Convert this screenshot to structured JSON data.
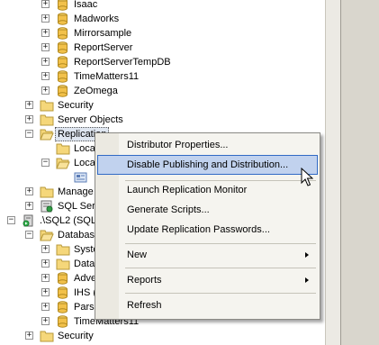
{
  "tree": {
    "databases_above": [
      "Isaac",
      "Madworks",
      "Mirrorsample",
      "ReportServer",
      "ReportServerTempDB",
      "TimeMatters11",
      "ZeOmega"
    ],
    "security": "Security",
    "server_objects": "Server Objects",
    "replication": "Replication",
    "local_publications": "Loca",
    "local_subscriptions": "Loca",
    "management": "Manage",
    "sql_server_agent": "SQL Serv",
    "server2": ".\\SQL2 (SQL",
    "databases": "Databas",
    "system_databases": "Syste",
    "db_snapshots": "Data",
    "adventure": "Adve",
    "ihs": "IHS (",
    "parsi": "Pars",
    "timematters": "TimeMatters11",
    "security2": "Security"
  },
  "context_menu": {
    "items": [
      {
        "label": "Distributor Properties...",
        "submenu": false
      },
      {
        "label": "Disable Publishing and Distribution...",
        "submenu": false
      },
      {
        "label": "Launch Replication Monitor",
        "submenu": false
      },
      {
        "label": "Generate Scripts...",
        "submenu": false
      },
      {
        "label": "Update Replication Passwords...",
        "submenu": false
      },
      {
        "label": "New",
        "submenu": true
      },
      {
        "label": "Reports",
        "submenu": true
      },
      {
        "label": "Refresh",
        "submenu": false
      }
    ]
  }
}
